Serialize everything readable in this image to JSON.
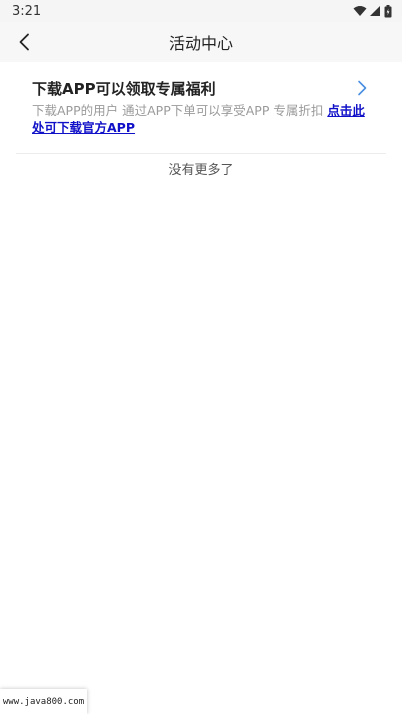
{
  "status_bar": {
    "time": "3:21",
    "icons": [
      "wifi-icon",
      "cell-signal-icon",
      "battery-icon"
    ]
  },
  "header": {
    "title": "活动中心",
    "back_icon": "chevron-left-icon"
  },
  "promo_card": {
    "title": "下载APP可以领取专属福利",
    "description": "下载APP的用户 通过APP下单可以享受APP 专属折扣",
    "link_text": "点击此处可下载官方APP",
    "chevron_icon": "chevron-right-icon",
    "colors": {
      "link": "#1010c8",
      "chevron": "#4a90e2",
      "desc": "#9a9a9a"
    }
  },
  "list_footer": {
    "text": "没有更多了"
  },
  "watermark": {
    "text": "www.java800.com"
  }
}
